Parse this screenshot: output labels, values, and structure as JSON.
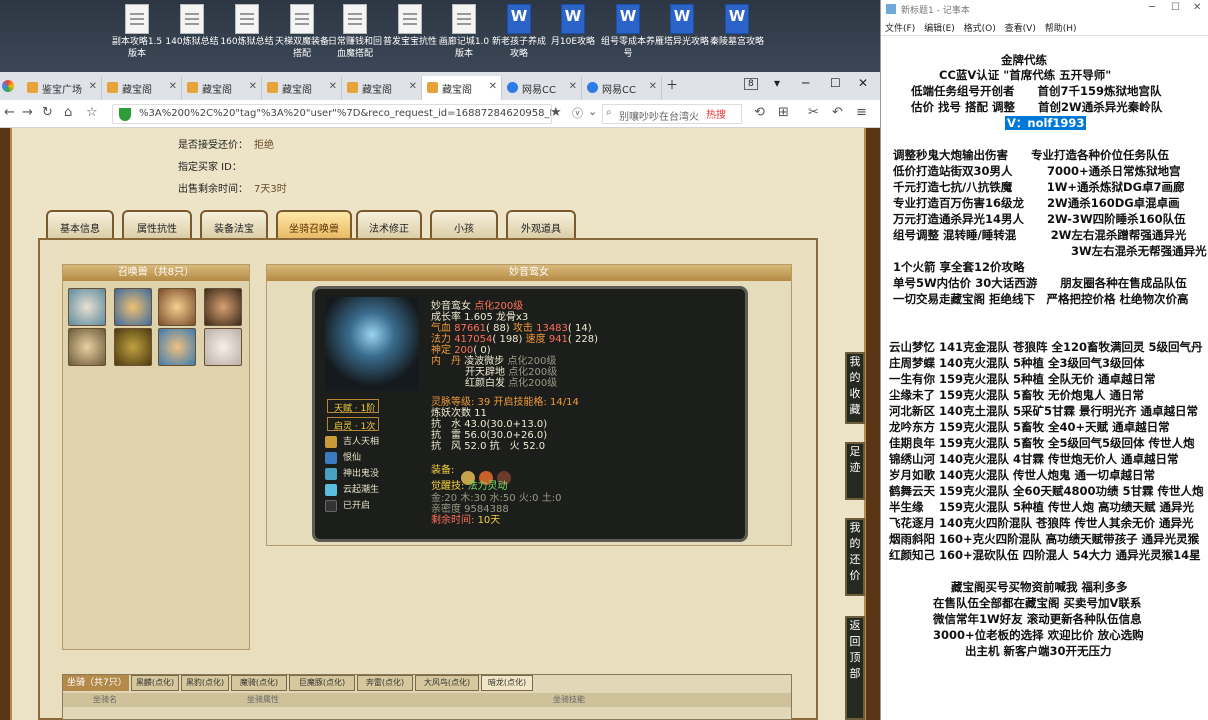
{
  "desktop_icons": [
    {
      "label": "副本攻略1.5版本",
      "type": "txt"
    },
    {
      "label": "140炼狱总结",
      "type": "txt"
    },
    {
      "label": "160炼狱总结",
      "type": "txt"
    },
    {
      "label": "天梯双魔装备搭配",
      "type": "txt"
    },
    {
      "label": "日常赚钱和回血魔搭配",
      "type": "txt"
    },
    {
      "label": "普发宝宝抗性",
      "type": "txt"
    },
    {
      "label": "画廊记城1.0版本",
      "type": "txt"
    },
    {
      "label": "新老孩子养成攻略",
      "type": "word"
    },
    {
      "label": "月10E攻略",
      "type": "word"
    },
    {
      "label": "组号零成本养号",
      "type": "word"
    },
    {
      "label": "雁塔异光攻略",
      "type": "word"
    },
    {
      "label": "秦陵墓宫攻略",
      "type": "word"
    }
  ],
  "browser": {
    "tabs": [
      {
        "label": "鉴宝广场"
      },
      {
        "label": "藏宝阁"
      },
      {
        "label": "藏宝阁"
      },
      {
        "label": "藏宝阁"
      },
      {
        "label": "藏宝阁"
      },
      {
        "label": "藏宝阁",
        "active": true
      },
      {
        "label": "网易CC"
      },
      {
        "label": "网易CC"
      }
    ],
    "tab_count": "8",
    "url": "%3A%200%2C%20\"tag\"%3A%20\"user\"%7D&reco_request_id=16887284620958_FJA",
    "search_text": "别嚷吵吵在台湾火",
    "hot_label": "热搜"
  },
  "game": {
    "info": [
      {
        "label": "是否接受还价：",
        "value": "拒绝"
      },
      {
        "label": "指定买家 ID：",
        "value": ""
      },
      {
        "label": "出售剩余时间：",
        "value": "7天3时"
      }
    ],
    "tabs": [
      "基本信息",
      "属性抗性",
      "装备法宝",
      "坐骑召唤兽",
      "法术修正",
      "小孩",
      "外观道具"
    ],
    "active_tab": "坐骑召唤兽",
    "summon_panel_title": "召唤兽（共8只）",
    "detail_panel_title": "妙音鸾女",
    "pet": {
      "name": "妙音鸾女",
      "name_note": "点化200级",
      "growth": "成长率 1.605 龙骨x3",
      "hp_label": "气血",
      "hp": "87661",
      "hp_sub": "( 88)",
      "atk_label": "攻击",
      "atk": "13483",
      "atk_sub": "( 14)",
      "mp_label": "法力",
      "mp": "417054",
      "mp_sub": "( 198)",
      "spd_label": "速度",
      "spd": "941",
      "spd_sub": "( 228)",
      "mind_label": "神定",
      "mind": "200",
      "mind_sub": "( 0)",
      "neidan_label": "内　丹",
      "neidan": [
        {
          "name": "凌波微步",
          "note": "点化200级"
        },
        {
          "name": "开天辟地",
          "note": "点化200级"
        },
        {
          "name": "红颜白发",
          "note": "点化200级"
        }
      ],
      "talent": "天赋 · 1阶",
      "qiling": "启灵 · 1次",
      "skills": [
        "吉人天相",
        "恨仙",
        "神出鬼没",
        "云起潮生",
        "已开启"
      ],
      "spirit_level": "灵脉等级: 39 开启技能格: 14/14",
      "refine": "炼妖次数 11",
      "resist": [
        {
          "label": "抗　水",
          "value": "43.0(30.0+13.0)"
        },
        {
          "label": "抗　雷",
          "value": "56.0(30.0+26.0)"
        },
        {
          "label": "抗　风",
          "value": "52.0",
          "extra_label": "抗　火",
          "extra_value": "52.0"
        }
      ],
      "equip_label": "装备:",
      "awaken_label": "觉醒技:",
      "awaken": "法力灵动",
      "elements": "金:20 木:30 水:50 火:0 土:0",
      "affinity": "亲密度 9584388",
      "remaining_label": "剩余时间:",
      "remaining": "10天"
    },
    "mounts": {
      "title": "坐骑（共7只）",
      "tabs": [
        "黑麟(点化)",
        "黑豹(点化)",
        "魔骑(点化)",
        "巨魔豚(点化)",
        "奔雷(点化)",
        "大风鸟(点化)",
        "暗龙(点化)"
      ],
      "col1": "坐骑名",
      "col2": "坐骑属性",
      "col3": "坐骑技能"
    },
    "side_buttons": [
      "我的收藏",
      "足迹",
      "我的还价",
      "返回顶部"
    ]
  },
  "notepad": {
    "title": "新标题1 - 记事本",
    "menu": [
      "文件(F)",
      "编辑(E)",
      "格式(O)",
      "查看(V)",
      "帮助(H)"
    ],
    "highlight": "V：nolf1993",
    "lines": [
      "金牌代练",
      "CC蓝V认证 \"首席代练 五开导师\"",
      "低端任务组号开创者　　首创7千159炼狱地宫队",
      "估价 找号 搭配 调整　　首创2W通杀异光秦岭队",
      "调整秒鬼大炮输出伤害　　专业打造各种价位任务队伍",
      "低价打造站街双30男人　　　7000+通杀日常炼狱地宫",
      "千元打造七抗/八抗铁魔　　　1W+通杀炼狱DG卓7画廊",
      "专业打造百万伤害16级龙　　2W通杀160DG卓混卓画",
      "万元打造通杀异光14男人　　2W-3W四阶睡杀160队伍",
      "组号调整 混转睡/睡转混　　　2W左右混杀蹭帮强通异光",
      "3W左右混杀无帮强通异光",
      "1个火箭 享全套12价攻略",
      "单号5W内估价 30大话西游　　朋友圈各种在售成品队伍",
      "一切交易走藏宝阁 拒绝线下　严格把控价格 杜绝物次价高",
      "云山梦忆 141克金混队 苍狼阵 全120畜牧满回灵 5级回气丹",
      "庄周梦蝶 140克火混队 5种植 全3级回气3级回体",
      "一生有你 159克火混队 5种植 全队无价 通卓越日常",
      "尘缘未了 159克火混队 5畜牧 无价炮鬼人 通日常",
      "河北新区 140克土混队 5采矿5甘霖 景行明光齐 通卓越日常",
      "龙吟东方 159克火混队 5畜牧 全40+天赋 通卓越日常",
      "佳期良年 159克火混队 5畜牧 全5级回气5级回体 传世人炮",
      "锦绣山河 140克火混队 4甘霖 传世炮无价人 通卓越日常",
      "岁月如歌 140克火混队 传世人炮鬼 通一切卓越日常",
      "鹤舞云天 159克火混队 全60天赋4800功绩 5甘霖 传世人炮",
      "半生缘　 159克火混队 5种植 传世人炮 高功绩天赋 通异光",
      "飞花逐月 140克火四阶混队 苍狼阵 传世人其余无价 通异光",
      "烟雨斜阳 160+克火四阶混队 高功绩天赋带孩子 通异光灵猴",
      "红颜知己 160+混砍队伍 四阶混人 54大力 通异光灵猴14星",
      "藏宝阁买号买物资前喊我 福利多多",
      "在售队伍全部都在藏宝阁 买卖号加V联系",
      "微信常年1W好友 滚动更新各种队伍信息",
      "3000+位老板的选择 欢迎比价 放心选购",
      "出主机 新客户端30开无压力"
    ]
  }
}
